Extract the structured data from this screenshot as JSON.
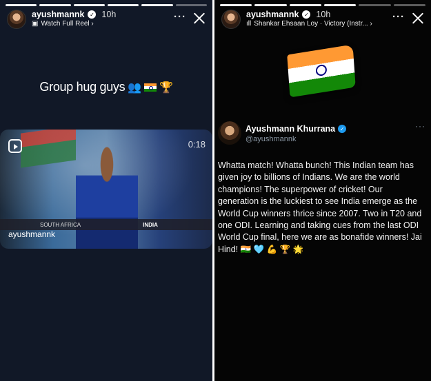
{
  "left_story": {
    "username": "ayushmannk",
    "time": "10h",
    "subtitle": "Watch Full Reel ›",
    "caption_text": "Group hug guys",
    "reel": {
      "duration": "0:18",
      "username": "ayushmannk",
      "ticker_team1": "SOUTH AFRICA",
      "ticker_team2": "INDIA"
    }
  },
  "right_story": {
    "username": "ayushmannk",
    "time": "10h",
    "music": "Shankar Ehsaan Loy · Victory (Instr... ›",
    "tweet": {
      "name": "Ayushmann Khurrana",
      "handle": "@ayushmannk",
      "text": "Whatta match! Whatta bunch! This Indian team has given joy to billions of Indians. We are the world champions! The superpower of cricket! Our generation is the luckiest to see India emerge as the World Cup winners thrice since 2007. Two in T20 and one ODI. Learning and taking cues from the last ODI World Cup final, here we are as bonafide winners! Jai Hind! 🇮🇳 🩵 💪 🏆 🌟"
    }
  },
  "icons": {
    "more": "more-icon",
    "close": "close-icon",
    "verified": "verified-icon",
    "reel": "reel-icon",
    "music": "music-bars-icon"
  }
}
